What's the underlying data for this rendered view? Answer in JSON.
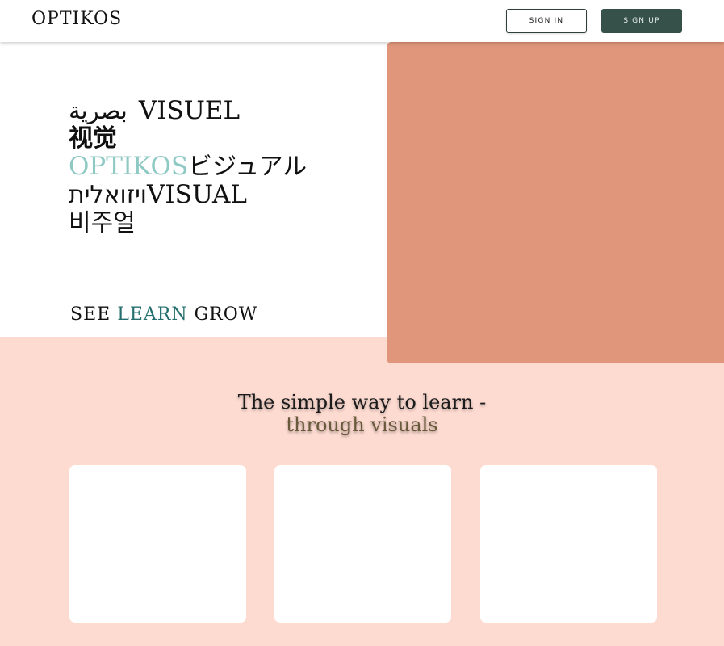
{
  "header": {
    "logo": "OPTIKOS",
    "sign_in_label": "SIGN IN",
    "sign_up_label": "SIGN UP"
  },
  "hero": {
    "line1_arabic": "بصرية",
    "line1_french": "VISUEL",
    "line2_chinese": "视觉",
    "line3_brand": "OPTIKOS",
    "line3_japanese": "ビジュアル",
    "line4_hebrew": "ויזואלית",
    "line4_english": "VISUAL",
    "line5_korean": "비주얼"
  },
  "tagline": {
    "see": "SEE",
    "learn": "LEARN",
    "grow": "GROW"
  },
  "section": {
    "title_line1": "The simple way to learn -",
    "title_line2": "through visuals"
  },
  "colors": {
    "hero_panel": "#e0967a",
    "lower_background": "#fddbd1",
    "accent_teal": "#256f6f",
    "accent_light_teal": "#8fc9c4",
    "button_dark": "#36504a"
  }
}
